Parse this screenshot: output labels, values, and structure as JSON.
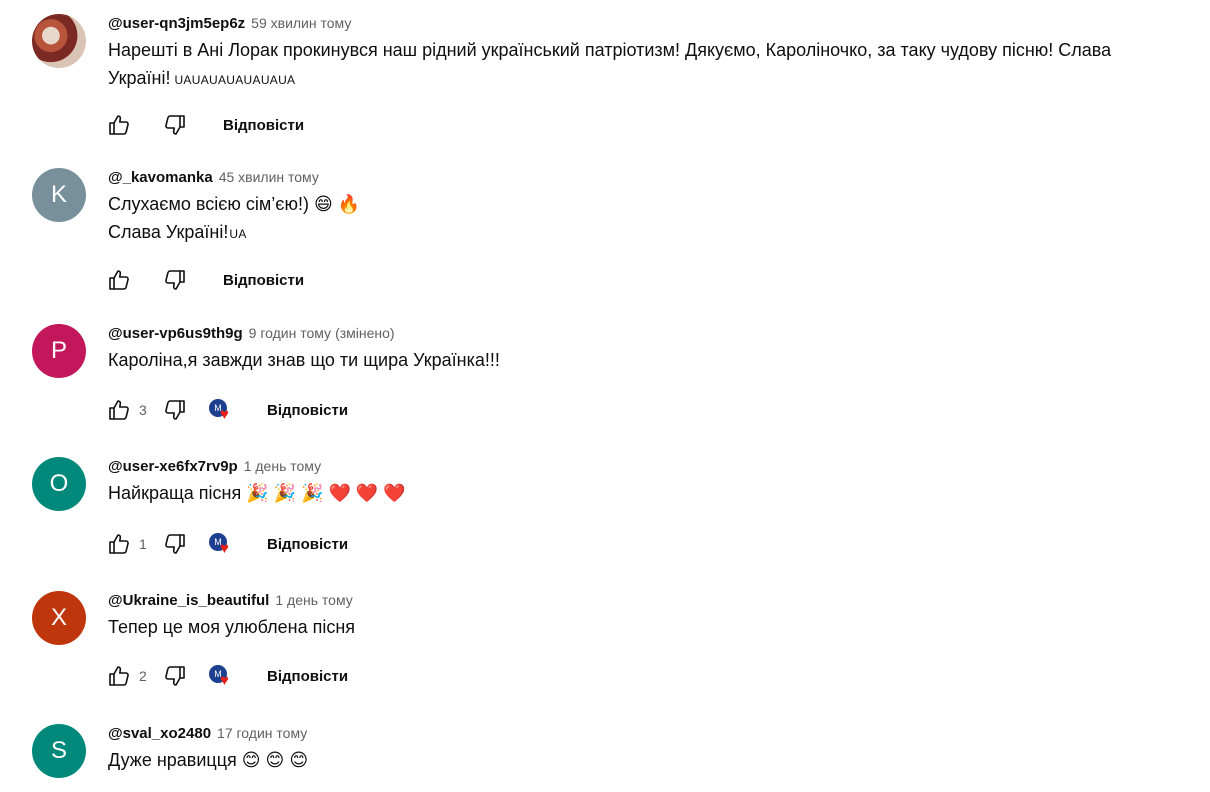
{
  "reply_label": "Відповісти",
  "colors": {
    "author": "#0f0f0f",
    "meta": "#606060",
    "heart": "#e62117"
  },
  "comments": [
    {
      "author": "@user-qn3jm5ep6z",
      "time": "59 хвилин тому",
      "text_line1": "Нарешті в Ані Лорак прокинувся наш рідний український патріотизм! Дякуємо, Кароліночко, за таку чудову пісню! Слава",
      "text_line2": "Україні!",
      "flag": "UAUAUAUAUAUAUA",
      "avatar": "photo",
      "likes": "",
      "hearted": false
    },
    {
      "author": "@_kavomanka",
      "time": "45 хвилин тому",
      "text_line1": "Слухаємо всією сім’єю!) 😄 🔥",
      "text_line2": "Слава Україні!",
      "flag": "UA",
      "avatar_letter": "K",
      "avatar_color": "#78909c",
      "likes": "",
      "hearted": false
    },
    {
      "author": "@user-vp6us9th9g",
      "time": "9 годин тому",
      "edited": "(змінено)",
      "text_line1": "Кароліна,я завжди знав що ти щира Українка!!!",
      "avatar_letter": "P",
      "avatar_color": "#c2185b",
      "likes": "3",
      "hearted": true
    },
    {
      "author": "@user-xe6fx7rv9p",
      "time": "1 день тому",
      "text_line1": "Найкраща пісня 🎉 🎉 🎉 ❤️ ❤️ ❤️",
      "avatar_letter": "O",
      "avatar_color": "#00897b",
      "likes": "1",
      "hearted": true
    },
    {
      "author": "@Ukraine_is_beautiful",
      "time": "1 день тому",
      "text_line1": "Тепер це моя улюблена пісня",
      "avatar_letter": "X",
      "avatar_color": "#bf360c",
      "likes": "2",
      "hearted": true
    },
    {
      "author": "@sval_xo2480",
      "time": "17 годин тому",
      "text_line1": "Дуже нравицця 😊 😊 😊",
      "avatar_letter": "S",
      "avatar_color": "#00897b",
      "likes": "",
      "hearted": false
    }
  ],
  "heart_badge_letter": "M",
  "icons": {
    "like": "thumbs-up-icon",
    "dislike": "thumbs-down-icon",
    "creator_heart": "creator-heart-icon"
  }
}
